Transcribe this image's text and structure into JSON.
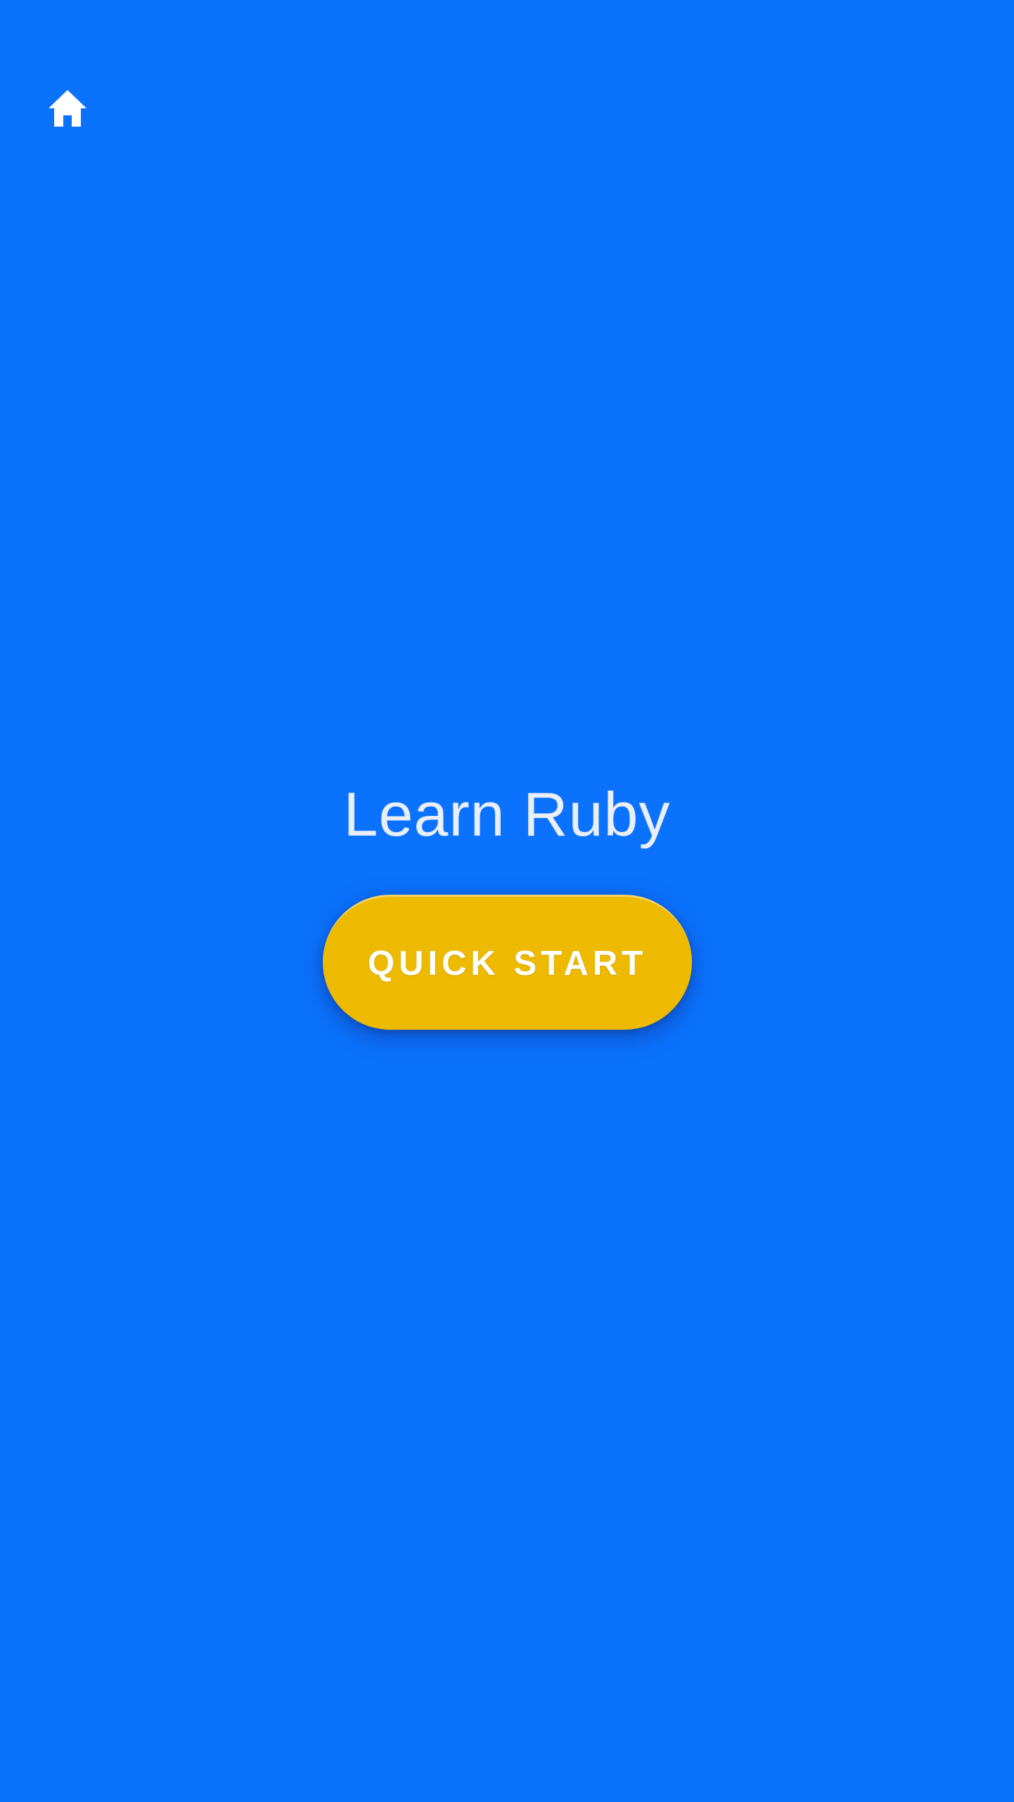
{
  "theme": {
    "background": "#0b72fe",
    "accent": "#eeba00",
    "title_color": "#e9eef7",
    "button_text_color": "#ffffff"
  },
  "toolbar": {
    "home_icon": "home-icon"
  },
  "main": {
    "title": "Learn Ruby",
    "quick_start_label": "QUICK START"
  }
}
